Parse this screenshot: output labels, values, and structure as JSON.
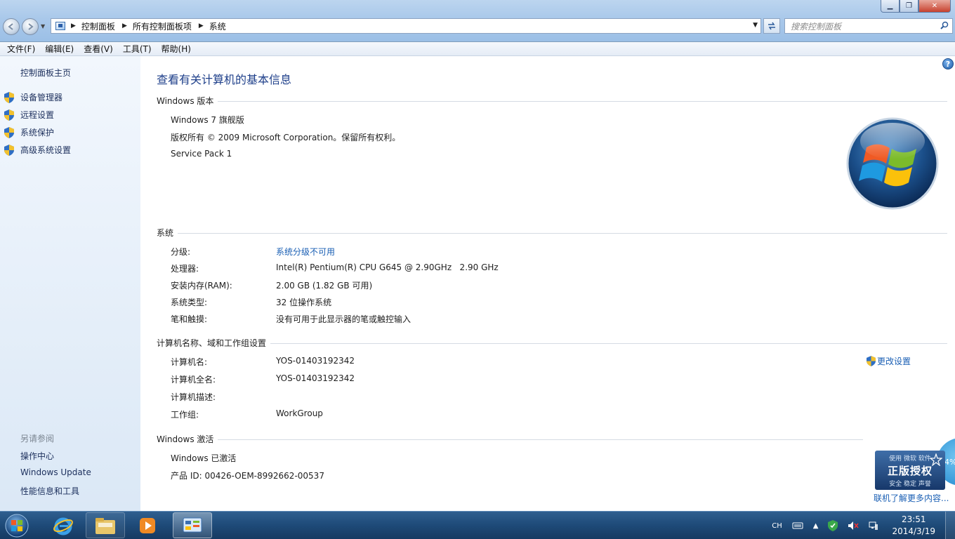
{
  "window": {
    "minimize_symbol": "▁",
    "maximize_symbol": "❐",
    "close_symbol": "✕"
  },
  "address_bar": {
    "crumbs": [
      "控制面板",
      "所有控制面板项",
      "系统"
    ],
    "search_placeholder": "搜索控制面板"
  },
  "menu": [
    "文件(F)",
    "编辑(E)",
    "查看(V)",
    "工具(T)",
    "帮助(H)"
  ],
  "sidebar": {
    "home": "控制面板主页",
    "tasks": [
      "设备管理器",
      "远程设置",
      "系统保护",
      "高级系统设置"
    ],
    "see_also_title": "另请参阅",
    "see_also": [
      "操作中心",
      "Windows Update",
      "性能信息和工具"
    ]
  },
  "main": {
    "title": "查看有关计算机的基本信息",
    "edition": {
      "heading": "Windows 版本",
      "name": "Windows 7 旗舰版",
      "copyright": "版权所有 © 2009 Microsoft Corporation。保留所有权利。",
      "service_pack": "Service Pack 1"
    },
    "system": {
      "heading": "系统",
      "rating_label": "分级:",
      "rating_value": "系统分级不可用",
      "processor_label": "处理器:",
      "processor_value": "Intel(R) Pentium(R) CPU G645 @ 2.90GHz   2.90 GHz",
      "ram_label": "安装内存(RAM):",
      "ram_value": "2.00 GB (1.82 GB 可用)",
      "type_label": "系统类型:",
      "type_value": "32 位操作系统",
      "pen_label": "笔和触摸:",
      "pen_value": "没有可用于此显示器的笔或触控输入"
    },
    "computer": {
      "heading": "计算机名称、域和工作组设置",
      "name_label": "计算机名:",
      "name_value": "YOS-01403192342",
      "fullname_label": "计算机全名:",
      "fullname_value": "YOS-01403192342",
      "desc_label": "计算机描述:",
      "desc_value": "",
      "workgroup_label": "工作组:",
      "workgroup_value": "WorkGroup",
      "change_settings": "更改设置"
    },
    "activation": {
      "heading": "Windows 激活",
      "status": "Windows 已激活",
      "product_id": "产品 ID: 00426-OEM-8992662-00537",
      "genuine_line1": "使用 微软 软件",
      "genuine_line2": "正版授权",
      "genuine_line3": "安全 稳定 声誉",
      "learn_more": "联机了解更多内容...",
      "progress_text": "34%"
    }
  },
  "taskbar": {
    "language": "CH",
    "time": "23:51",
    "date": "2014/3/19"
  },
  "colors": {
    "link": "#1a5fb4",
    "title": "#1e3f8a",
    "taskbar": "#1e4a78"
  }
}
